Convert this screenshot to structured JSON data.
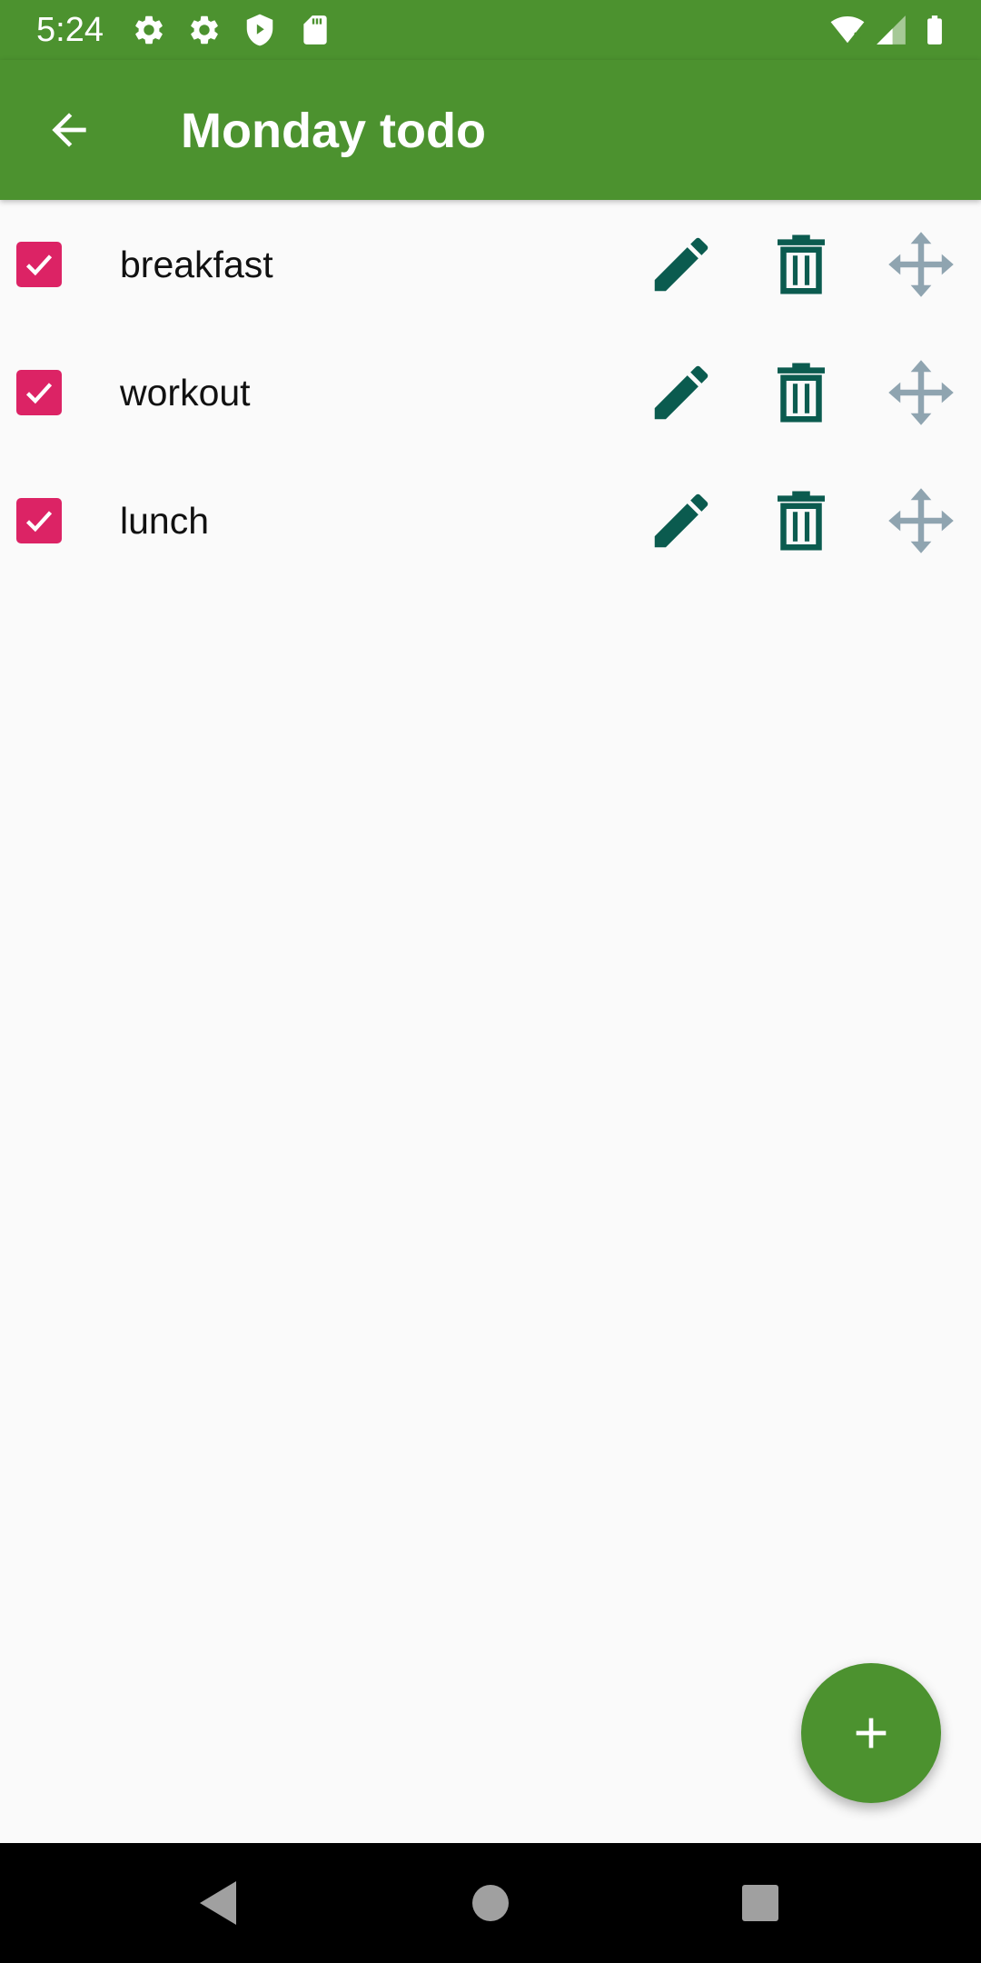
{
  "status_bar": {
    "time": "5:24",
    "icons": [
      "settings-icon",
      "settings-icon",
      "shield-play-icon",
      "sd-card-icon",
      "wifi-icon",
      "cell-signal-icon",
      "battery-icon"
    ]
  },
  "app_bar": {
    "title": "Monday todo",
    "back_icon": "arrow-back-icon"
  },
  "todos": [
    {
      "label": "breakfast",
      "checked": true
    },
    {
      "label": "workout",
      "checked": true
    },
    {
      "label": "lunch",
      "checked": true
    }
  ],
  "row_actions": [
    "pencil-icon",
    "trash-icon",
    "move-icon"
  ],
  "fab": {
    "icon": "plus-icon"
  },
  "nav_bar": {
    "buttons": [
      "back-triangle-icon",
      "home-circle-icon",
      "recents-square-icon"
    ]
  },
  "colors": {
    "primary": "#4c922f",
    "checkbox": "#dc2365",
    "action_icon": "#0b5b4f",
    "move_icon": "#8fa4b0",
    "background": "#fafafa"
  }
}
